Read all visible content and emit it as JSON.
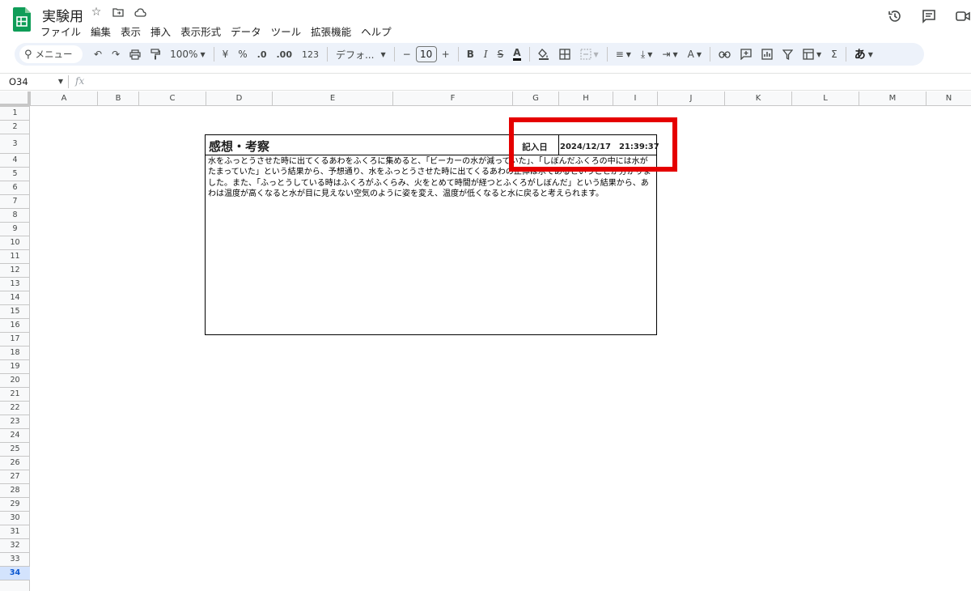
{
  "app": {
    "title": "実験用",
    "menu": [
      "ファイル",
      "編集",
      "表示",
      "挿入",
      "表示形式",
      "データ",
      "ツール",
      "拡張機能",
      "ヘルプ"
    ]
  },
  "toolbar": {
    "search_label": "メニュー",
    "zoom": "100%",
    "currency": "¥",
    "percent": "%",
    "decimal_decrease": ".0",
    "decimal_increase": ".00",
    "number_format": "123",
    "font": "デフォ...",
    "font_size": "10",
    "ime": "あ"
  },
  "formula_bar": {
    "cell_ref": "O34",
    "fx_label": "fx"
  },
  "grid": {
    "columns": [
      "A",
      "B",
      "C",
      "D",
      "E",
      "F",
      "G",
      "H",
      "I",
      "J",
      "K",
      "L",
      "M",
      "N"
    ],
    "rows": [
      "1",
      "2",
      "3",
      "4",
      "5",
      "6",
      "7",
      "8",
      "9",
      "10",
      "11",
      "12",
      "13",
      "14",
      "15",
      "16",
      "17",
      "18",
      "19",
      "20",
      "21",
      "22",
      "23",
      "24",
      "25",
      "26",
      "27",
      "28",
      "29",
      "30",
      "31",
      "32",
      "33",
      "34"
    ],
    "selected_row": "34"
  },
  "sheet": {
    "heading": "感想・考察",
    "date_label": "記入日",
    "date_value": "2024/12/17　21:39:37",
    "body": "水をふっとうさせた時に出てくるあわをふくろに集めると、「ビーカーの水が減っていた」、「しぼんだふくろの中には水がたまっていた」という結果から、予想通り、水をふっとうさせた時に出てくるあわの正体は水であるということが分かりました。また、「ふっとうしている時はふくろがふくらみ、火をとめて時間が経つとふくろがしぼんだ」という結果から、あわは温度が高くなると水が目に見えない空気のように姿を変え、温度が低くなると水に戻ると考えられます。"
  },
  "colors": {
    "highlight": "#e50000",
    "toolbar_bg": "#edf2fa",
    "logo_green": "#0f9d58",
    "selected_row_bg": "#d3e3fd"
  }
}
